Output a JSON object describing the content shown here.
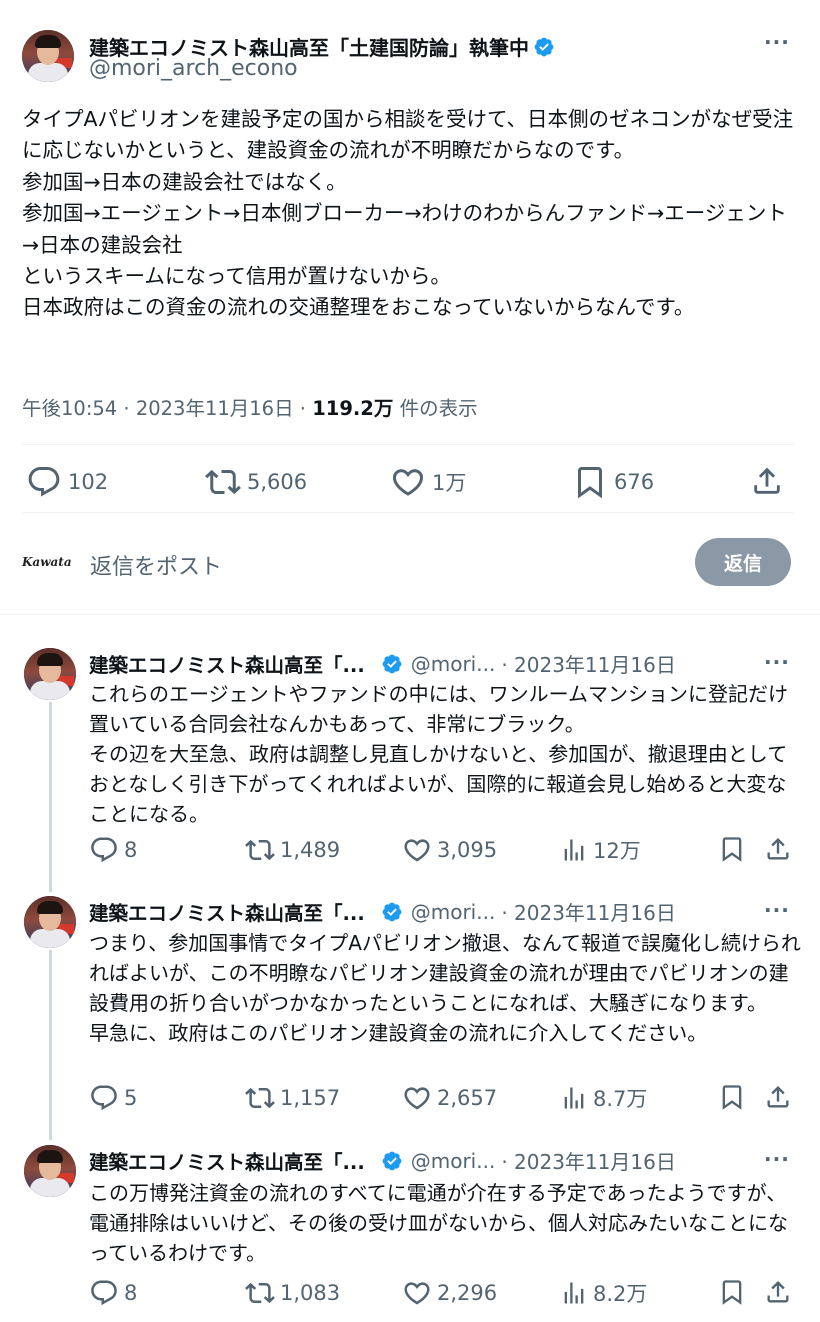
{
  "main": {
    "author_name": "建築エコノミスト森山高至「土建国防論」執筆中",
    "author_handle": "@mori_arch_econo",
    "text": "タイプAパビリオンを建設予定の国から相談を受けて、日本側のゼネコンがなぜ受注に応じないかというと、建設資金の流れが不明瞭だからなのです。\n参加国→日本の建設会社ではなく。\n参加国→エージェント→日本側ブローカー→わけのわからんファンド→エージェント→日本の建設会社\nというスキームになって信用が置けないから。\n日本政府はこの資金の流れの交通整理をおこなっていないからなんです。",
    "time": "午後10:54",
    "date": "2023年11月16日",
    "views_count": "119.2万",
    "views_label": "件の表示",
    "replies": "102",
    "reposts": "5,606",
    "likes": "1万",
    "bookmarks": "676"
  },
  "reply_box": {
    "avatar_text": "Kawata",
    "placeholder": "返信をポスト",
    "button_label": "返信"
  },
  "thread": [
    {
      "author_name": "建築エコノミスト森山高至「...",
      "author_handle": "@mori...",
      "date": "· 2023年11月16日",
      "text": "これらのエージェントやファンドの中には、ワンルームマンションに登記だけ置いている合同会社なんかもあって、非常にブラック。\nその辺を大至急、政府は調整し見直しかけないと、参加国が、撤退理由としておとなしく引き下がってくれればよいが、国際的に報道会見し始めると大変なことになる。",
      "replies": "8",
      "reposts": "1,489",
      "likes": "3,095",
      "views": "12万"
    },
    {
      "author_name": "建築エコノミスト森山高至「...",
      "author_handle": "@mori...",
      "date": "· 2023年11月16日",
      "text": "つまり、参加国事情でタイプAパビリオン撤退、なんて報道で誤魔化し続けられればよいが、この不明瞭なパビリオン建設資金の流れが理由でパビリオンの建設費用の折り合いがつかなかったということになれば、大騒ぎになります。\n早急に、政府はこのパビリオン建設資金の流れに介入してください。",
      "replies": "5",
      "reposts": "1,157",
      "likes": "2,657",
      "views": "8.7万"
    },
    {
      "author_name": "建築エコノミスト森山高至「...",
      "author_handle": "@mori...",
      "date": "· 2023年11月16日",
      "text": "この万博発注資金の流れのすべてに電通が介在する予定であったようですが、電通排除はいいけど、その後の受け皿がないから、個人対応みたいなことになっているわけです。",
      "replies": "8",
      "reposts": "1,083",
      "likes": "2,296",
      "views": "8.2万"
    }
  ],
  "colors": {
    "verified": "#1d9bf0",
    "muted": "#536471",
    "reply_button": "#8b98a5",
    "thread_line": "#cfd9de"
  }
}
